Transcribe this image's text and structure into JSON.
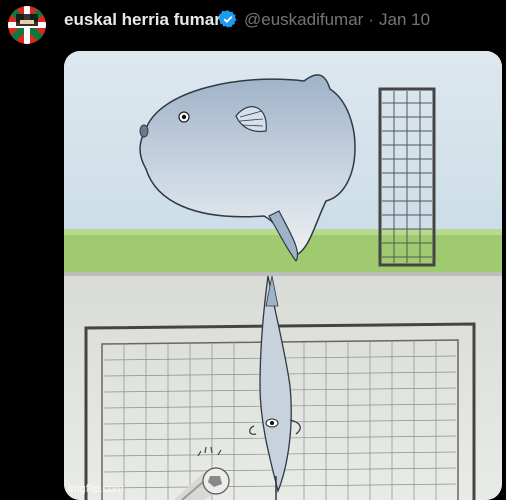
{
  "tweet": {
    "display_name": "euskal herria fumar",
    "handle": "@euskadifumar",
    "separator": "·",
    "date": "Jan 10",
    "verified": true
  },
  "avatar": {
    "icon": "basque-flag-icon",
    "colors": {
      "green": "#0b7a3c",
      "red": "#d52b1e",
      "white": "#ffffff"
    }
  },
  "media": {
    "panels": [
      {
        "icon": "sunfish-and-goal-illustration"
      },
      {
        "icon": "sunfish-blocking-goal-illustration"
      }
    ],
    "watermark": "imgflip.com"
  },
  "colors": {
    "background": "#000000",
    "name_text": "#e7e9ea",
    "secondary_text": "#71767b",
    "verified_blue": "#1d9bf0"
  }
}
